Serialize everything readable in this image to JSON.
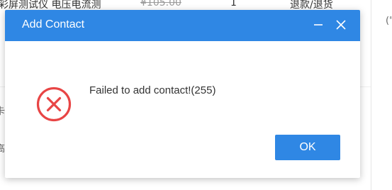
{
  "background": {
    "row_product": "彩屏测试仪 电压电流测",
    "row_price": "¥105.00",
    "row_qty": "1",
    "row_action": "退款/退货",
    "left_char_1": "卡",
    "left_char_2": "高",
    "right_char": "(\""
  },
  "dialog": {
    "title": "Add Contact",
    "message": "Failed to add contact!(255)",
    "ok_label": "OK",
    "header_icons": [
      "minimize-icon",
      "close-icon"
    ],
    "status_icon": "error-icon"
  },
  "colors": {
    "accent": "#2f87e4",
    "error": "#e84545"
  }
}
